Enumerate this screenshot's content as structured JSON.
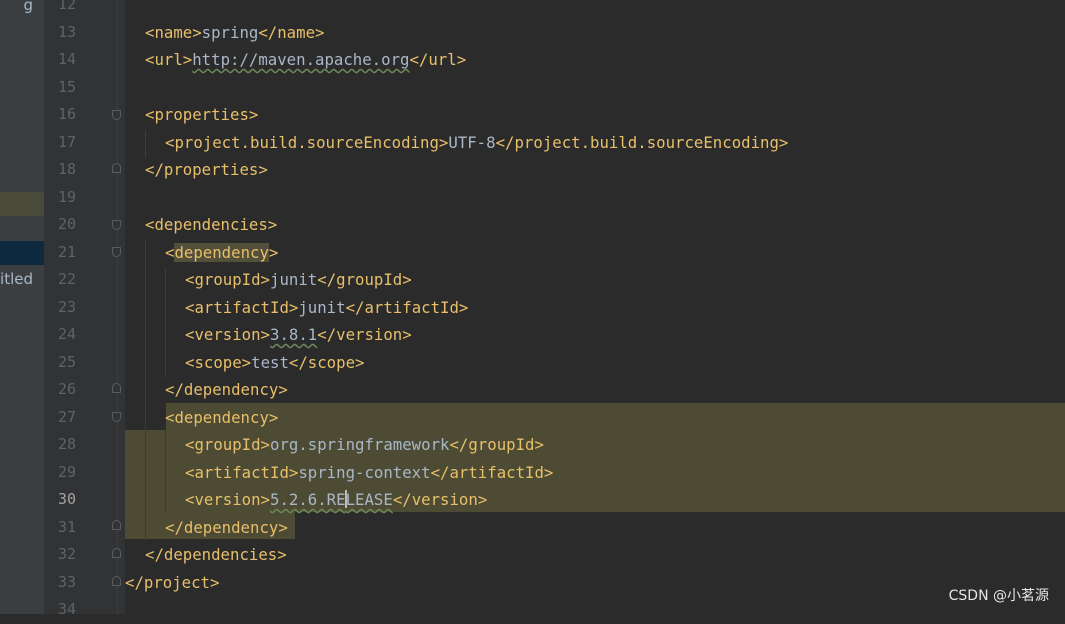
{
  "sidebar": {
    "items": [
      {
        "label": "g",
        "state": "normal"
      },
      {
        "label": "",
        "state": "highlight-olive"
      },
      {
        "label": "",
        "state": "selected-blue"
      },
      {
        "label": "itled",
        "state": "normal"
      }
    ]
  },
  "editor": {
    "current_line": "30",
    "lines": [
      {
        "num": "12",
        "code": ""
      },
      {
        "num": "13",
        "code": "<name>spring</name>"
      },
      {
        "num": "14",
        "code": "<url>http://maven.apache.org</url>"
      },
      {
        "num": "15",
        "code": ""
      },
      {
        "num": "16",
        "code": "<properties>"
      },
      {
        "num": "17",
        "code": "<project.build.sourceEncoding>UTF-8</project.build.sourceEncoding>"
      },
      {
        "num": "18",
        "code": "</properties>"
      },
      {
        "num": "19",
        "code": ""
      },
      {
        "num": "20",
        "code": "<dependencies>"
      },
      {
        "num": "21",
        "code": "<dependency>"
      },
      {
        "num": "22",
        "code": "<groupId>junit</groupId>"
      },
      {
        "num": "23",
        "code": "<artifactId>junit</artifactId>"
      },
      {
        "num": "24",
        "code": "<version>3.8.1</version>"
      },
      {
        "num": "25",
        "code": "<scope>test</scope>"
      },
      {
        "num": "26",
        "code": "</dependency>"
      },
      {
        "num": "27",
        "code": "<dependency>"
      },
      {
        "num": "28",
        "code": "<groupId>org.springframework</groupId>"
      },
      {
        "num": "29",
        "code": "<artifactId>spring-context</artifactId>"
      },
      {
        "num": "30",
        "code": "<version>5.2.6.RELEASE</version>"
      },
      {
        "num": "31",
        "code": "</dependency>"
      },
      {
        "num": "32",
        "code": "</dependencies>"
      },
      {
        "num": "33",
        "code": "</project>"
      },
      {
        "num": "34",
        "code": ""
      }
    ]
  },
  "watermark": "CSDN @小茗源",
  "colors": {
    "background": "#2b2b2b",
    "gutter": "#313335",
    "tag": "#e8bf6a",
    "text": "#a9b7c6",
    "selection": "#4d4b33",
    "highlighted_tag": "#524f3a"
  }
}
